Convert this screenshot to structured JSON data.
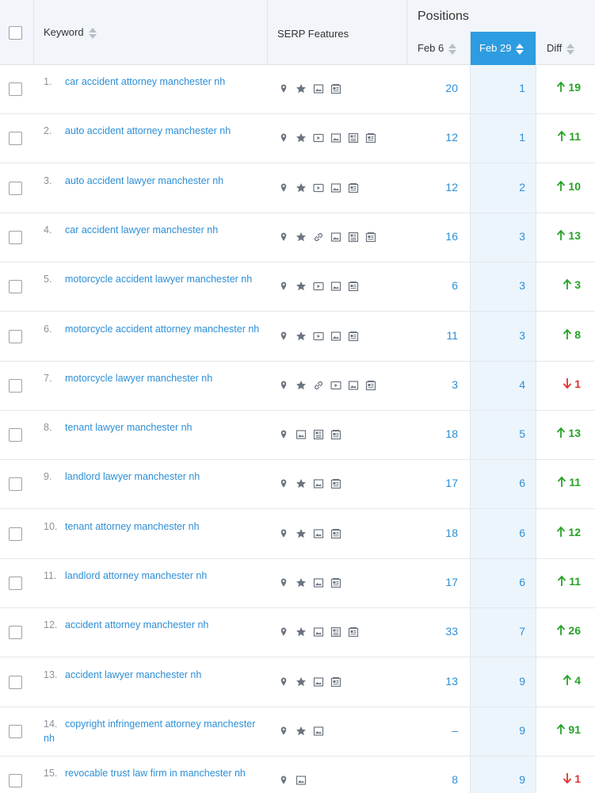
{
  "header": {
    "keyword_label": "Keyword",
    "serp_label": "SERP Features",
    "positions_label": "Positions",
    "feb6_label": "Feb 6",
    "feb29_label": "Feb 29",
    "diff_label": "Diff"
  },
  "colors": {
    "link": "#2d8fd5",
    "selected_column": "#2d9ce0",
    "up": "#27a327",
    "down": "#e0312f"
  },
  "rows": [
    {
      "num": "1.",
      "keyword": "car accident attorney manchester nh",
      "features": [
        "map-pin-icon",
        "star-icon",
        "image-icon",
        "news-icon"
      ],
      "feb6": "20",
      "feb29": "1",
      "diff": "19",
      "dir": "up"
    },
    {
      "num": "2.",
      "keyword": "auto accident attorney manchester nh",
      "features": [
        "map-pin-icon",
        "star-icon",
        "video-icon",
        "image-icon",
        "knowledge-panel-icon",
        "news-icon"
      ],
      "feb6": "12",
      "feb29": "1",
      "diff": "11",
      "dir": "up"
    },
    {
      "num": "3.",
      "keyword": "auto accident lawyer manchester nh",
      "features": [
        "map-pin-icon",
        "star-icon",
        "video-icon",
        "image-icon",
        "news-icon"
      ],
      "feb6": "12",
      "feb29": "2",
      "diff": "10",
      "dir": "up"
    },
    {
      "num": "4.",
      "keyword": "car accident lawyer manchester nh",
      "features": [
        "map-pin-icon",
        "star-icon",
        "link-icon",
        "image-icon",
        "knowledge-panel-icon",
        "news-icon"
      ],
      "feb6": "16",
      "feb29": "3",
      "diff": "13",
      "dir": "up"
    },
    {
      "num": "5.",
      "keyword": "motorcycle accident lawyer manchester nh",
      "features": [
        "map-pin-icon",
        "star-icon",
        "video-icon",
        "image-icon",
        "news-icon"
      ],
      "feb6": "6",
      "feb29": "3",
      "diff": "3",
      "dir": "up"
    },
    {
      "num": "6.",
      "keyword": "motorcycle accident attorney manchester nh",
      "features": [
        "map-pin-icon",
        "star-icon",
        "video-icon",
        "image-icon",
        "news-icon"
      ],
      "feb6": "11",
      "feb29": "3",
      "diff": "8",
      "dir": "up"
    },
    {
      "num": "7.",
      "keyword": "motorcycle lawyer manchester nh",
      "features": [
        "map-pin-icon",
        "star-icon",
        "link-icon",
        "video-icon",
        "image-icon",
        "news-icon"
      ],
      "feb6": "3",
      "feb29": "4",
      "diff": "1",
      "dir": "down"
    },
    {
      "num": "8.",
      "keyword": "tenant lawyer manchester nh",
      "features": [
        "map-pin-icon",
        "image-icon",
        "knowledge-panel-icon",
        "news-icon"
      ],
      "feb6": "18",
      "feb29": "5",
      "diff": "13",
      "dir": "up"
    },
    {
      "num": "9.",
      "keyword": "landlord lawyer manchester nh",
      "features": [
        "map-pin-icon",
        "star-icon",
        "image-icon",
        "news-icon"
      ],
      "feb6": "17",
      "feb29": "6",
      "diff": "11",
      "dir": "up"
    },
    {
      "num": "10.",
      "keyword": "tenant attorney manchester nh",
      "features": [
        "map-pin-icon",
        "star-icon",
        "image-icon",
        "news-icon"
      ],
      "feb6": "18",
      "feb29": "6",
      "diff": "12",
      "dir": "up"
    },
    {
      "num": "11.",
      "keyword": "landlord attorney manchester nh",
      "features": [
        "map-pin-icon",
        "star-icon",
        "image-icon",
        "news-icon"
      ],
      "feb6": "17",
      "feb29": "6",
      "diff": "11",
      "dir": "up"
    },
    {
      "num": "12.",
      "keyword": "accident attorney manchester nh",
      "features": [
        "map-pin-icon",
        "star-icon",
        "image-icon",
        "knowledge-panel-icon",
        "news-icon"
      ],
      "feb6": "33",
      "feb29": "7",
      "diff": "26",
      "dir": "up"
    },
    {
      "num": "13.",
      "keyword": "accident lawyer manchester nh",
      "features": [
        "map-pin-icon",
        "star-icon",
        "image-icon",
        "news-icon"
      ],
      "feb6": "13",
      "feb29": "9",
      "diff": "4",
      "dir": "up"
    },
    {
      "num": "14.",
      "keyword": "copyright infringement attorney manchester nh",
      "features": [
        "map-pin-icon",
        "star-icon",
        "image-icon"
      ],
      "feb6": "–",
      "feb29": "9",
      "diff": "91",
      "dir": "up"
    },
    {
      "num": "15.",
      "keyword": "revocable trust law firm in manchester nh",
      "features": [
        "map-pin-icon",
        "image-icon"
      ],
      "feb6": "8",
      "feb29": "9",
      "diff": "1",
      "dir": "down"
    }
  ]
}
